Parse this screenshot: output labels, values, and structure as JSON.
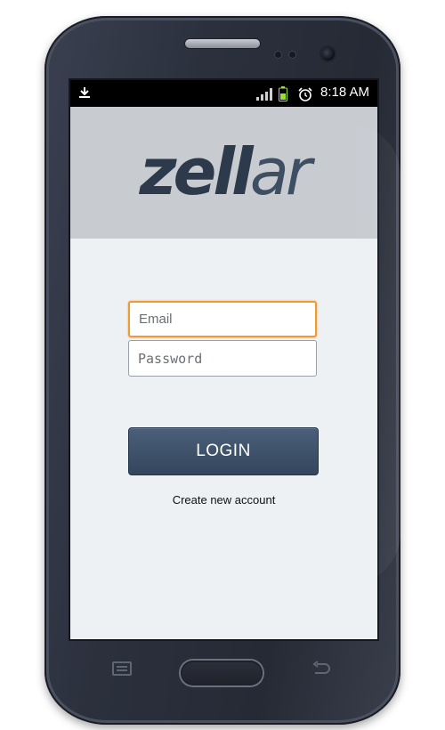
{
  "status_bar": {
    "time": "8:18 AM",
    "icons": [
      "download-icon",
      "signal-icon",
      "battery-icon",
      "alarm-icon"
    ],
    "battery_color": "#9be32a"
  },
  "brand": {
    "logo_part1": "zell",
    "logo_part2": "ar",
    "logo_color": "#2c3a4c"
  },
  "form": {
    "email_placeholder": "Email",
    "password_placeholder": "Password",
    "login_label": "LOGIN",
    "create_account_label": "Create new account"
  },
  "colors": {
    "header_bg": "#c8ccd1",
    "screen_bg": "#eef1f3",
    "button_bg": "#3d5068",
    "focus_border": "#f29a30"
  },
  "hardware_keys": [
    "menu-key-icon",
    "home-button",
    "back-key-icon"
  ]
}
